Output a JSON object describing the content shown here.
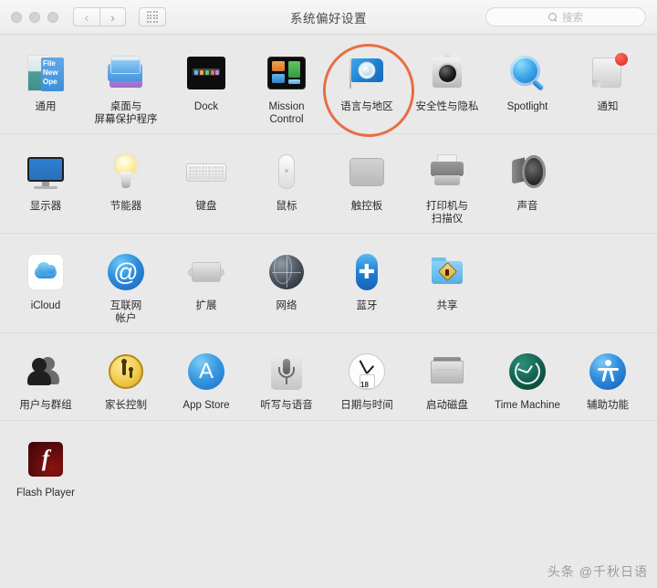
{
  "window": {
    "title": "系统偏好设置",
    "traffic_lights": [
      "close",
      "minimize",
      "zoom"
    ],
    "nav": {
      "back_label": "‹",
      "forward_label": "›",
      "grid_label": "grid"
    },
    "search": {
      "placeholder": "搜索",
      "value": ""
    }
  },
  "annotation": {
    "target": "语言与地区",
    "color": "#e8673c"
  },
  "watermark": {
    "text": "头条 @千秋日语"
  },
  "rows": [
    {
      "panes": [
        {
          "label": "通用",
          "icon": "general-icon",
          "doc_text": "File\nNew\nOpe"
        },
        {
          "label": "桌面与\n屏幕保护程序",
          "icon": "desktop-screensaver-icon"
        },
        {
          "label": "Dock",
          "icon": "dock-icon"
        },
        {
          "label": "Mission\nControl",
          "icon": "mission-control-icon"
        },
        {
          "label": "语言与地区",
          "icon": "language-region-icon"
        },
        {
          "label": "安全性与隐私",
          "icon": "security-privacy-icon"
        },
        {
          "label": "Spotlight",
          "icon": "spotlight-icon"
        },
        {
          "label": "通知",
          "icon": "notifications-icon",
          "badge": true
        }
      ]
    },
    {
      "panes": [
        {
          "label": "显示器",
          "icon": "displays-icon"
        },
        {
          "label": "节能器",
          "icon": "energy-saver-icon"
        },
        {
          "label": "键盘",
          "icon": "keyboard-icon"
        },
        {
          "label": "鼠标",
          "icon": "mouse-icon"
        },
        {
          "label": "触控板",
          "icon": "trackpad-icon"
        },
        {
          "label": "打印机与\n扫描仪",
          "icon": "printers-scanners-icon"
        },
        {
          "label": "声音",
          "icon": "sound-icon"
        }
      ]
    },
    {
      "panes": [
        {
          "label": "iCloud",
          "icon": "icloud-icon"
        },
        {
          "label": "互联网\n帐户",
          "icon": "internet-accounts-icon",
          "glyph": "@"
        },
        {
          "label": "扩展",
          "icon": "extensions-icon"
        },
        {
          "label": "网络",
          "icon": "network-icon"
        },
        {
          "label": "蓝牙",
          "icon": "bluetooth-icon",
          "glyph": "✚"
        },
        {
          "label": "共享",
          "icon": "sharing-icon"
        }
      ]
    },
    {
      "panes": [
        {
          "label": "用户与群组",
          "icon": "users-groups-icon"
        },
        {
          "label": "家长控制",
          "icon": "parental-controls-icon"
        },
        {
          "label": "App Store",
          "icon": "app-store-icon",
          "glyph": "A"
        },
        {
          "label": "听写与语音",
          "icon": "dictation-speech-icon"
        },
        {
          "label": "日期与时间",
          "icon": "date-time-icon",
          "day": "18"
        },
        {
          "label": "启动磁盘",
          "icon": "startup-disk-icon"
        },
        {
          "label": "Time Machine",
          "icon": "time-machine-icon"
        },
        {
          "label": "辅助功能",
          "icon": "accessibility-icon"
        }
      ]
    },
    {
      "panes": [
        {
          "label": "Flash Player",
          "icon": "flash-player-icon",
          "glyph": "f"
        }
      ]
    }
  ]
}
